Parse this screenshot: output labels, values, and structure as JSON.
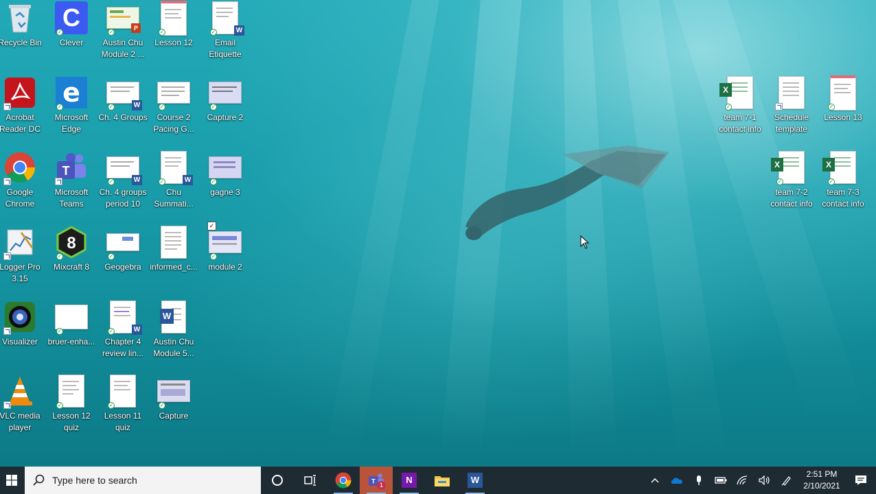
{
  "desktop": {
    "icons": [
      {
        "label": "Recycle Bin",
        "icon": "recycle-bin-icon"
      },
      {
        "label": "Clever",
        "icon": "clever-app-icon"
      },
      {
        "label": "Austin Chu\nModule 2 ...",
        "icon": "powerpoint-file-icon"
      },
      {
        "label": "Lesson 12",
        "icon": "document-file-icon"
      },
      {
        "label": "Email\nEtiquette",
        "icon": "word-file-icon"
      },
      {
        "label": "Acrobat\nReader DC",
        "icon": "acrobat-reader-icon"
      },
      {
        "label": "Microsoft\nEdge",
        "icon": "edge-browser-icon"
      },
      {
        "label": "Ch. 4 Groups",
        "icon": "word-file-icon"
      },
      {
        "label": "Course 2\nPacing G...",
        "icon": "document-file-icon"
      },
      {
        "label": "Capture 2",
        "icon": "image-file-icon"
      },
      {
        "label": "Google\nChrome",
        "icon": "chrome-browser-icon"
      },
      {
        "label": "Microsoft\nTeams",
        "icon": "teams-app-icon"
      },
      {
        "label": "Ch. 4 groups\nperiod 10",
        "icon": "word-file-icon"
      },
      {
        "label": "Chu\nSummati...",
        "icon": "word-file-icon"
      },
      {
        "label": "gagne 3",
        "icon": "image-file-icon"
      },
      {
        "label": "Logger Pro\n3.15",
        "icon": "logger-pro-icon"
      },
      {
        "label": "Mixcraft 8",
        "icon": "mixcraft-app-icon"
      },
      {
        "label": "Geogebra",
        "icon": "image-file-icon"
      },
      {
        "label": "informed_c...",
        "icon": "document-file-icon"
      },
      {
        "label": "module 2",
        "icon": "image-file-icon"
      },
      {
        "label": "Visualizer",
        "icon": "visualizer-app-icon"
      },
      {
        "label": "bruer-enha...",
        "icon": "image-file-icon"
      },
      {
        "label": "Chapter 4\nreview lin...",
        "icon": "word-file-icon"
      },
      {
        "label": "Austin Chu\nModule 5...",
        "icon": "word-file-icon"
      },
      {
        "label": "VLC media\nplayer",
        "icon": "vlc-player-icon"
      },
      {
        "label": "Lesson 12\nquiz",
        "icon": "document-file-icon"
      },
      {
        "label": "Lesson 11\nquiz",
        "icon": "document-file-icon"
      },
      {
        "label": "Capture",
        "icon": "image-file-icon"
      },
      {
        "label": "team 7-1\ncontact info",
        "icon": "excel-file-icon"
      },
      {
        "label": "Schedule\ntemplate",
        "icon": "document-file-icon"
      },
      {
        "label": "Lesson 13",
        "icon": "document-file-icon"
      },
      {
        "label": "team 7-2\ncontact info",
        "icon": "excel-file-icon"
      },
      {
        "label": "team 7-3\ncontact info",
        "icon": "excel-file-icon"
      }
    ]
  },
  "taskbar": {
    "search_placeholder": "Type here to search",
    "teams_badge": "1",
    "apps": [
      "cortana-icon",
      "task-view-icon",
      "chrome-icon",
      "teams-icon",
      "onenote-icon",
      "file-explorer-icon",
      "word-icon"
    ],
    "clock_time": "2:51 PM",
    "clock_date": "2/10/2021"
  },
  "colors": {
    "taskbar_bg": "#1f2b33",
    "water": "#1a9eac"
  }
}
